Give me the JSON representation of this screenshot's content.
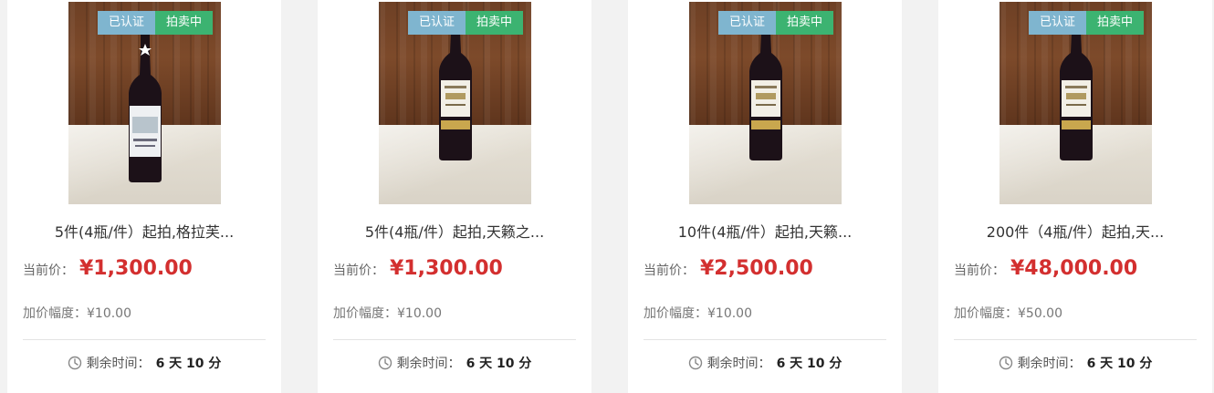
{
  "cards": [
    {
      "badges": {
        "certified": "已认证",
        "status": "拍卖中"
      },
      "title": "5件(4瓶/件）起拍,格拉芙...",
      "price_label": "当前价：",
      "price": "¥1,300.00",
      "increment_label": "加价幅度：",
      "increment": "¥10.00",
      "time_label": "剩余时间：",
      "time_left": "6 天 10 分",
      "bottle_label": "white"
    },
    {
      "badges": {
        "certified": "已认证",
        "status": "拍卖中"
      },
      "title": "5件(4瓶/件）起拍,天籁之...",
      "price_label": "当前价：",
      "price": "¥1,300.00",
      "increment_label": "加价幅度：",
      "increment": "¥10.00",
      "time_label": "剩余时间：",
      "time_left": "6 天 10 分",
      "bottle_label": "cream"
    },
    {
      "badges": {
        "certified": "已认证",
        "status": "拍卖中"
      },
      "title": "10件(4瓶/件）起拍,天籁...",
      "price_label": "当前价：",
      "price": "¥2,500.00",
      "increment_label": "加价幅度：",
      "increment": "¥10.00",
      "time_label": "剩余时间：",
      "time_left": "6 天 10 分",
      "bottle_label": "cream"
    },
    {
      "badges": {
        "certified": "已认证",
        "status": "拍卖中"
      },
      "title": "200件（4瓶/件）起拍,天...",
      "price_label": "当前价：",
      "price": "¥48,000.00",
      "increment_label": "加价幅度：",
      "increment": "¥50.00",
      "time_label": "剩余时间：",
      "time_left": "6 天 10 分",
      "bottle_label": "cream"
    }
  ],
  "colors": {
    "badge_certified": "#7fb5cf",
    "badge_status": "#3cb371",
    "price": "#d32f2f"
  },
  "icons": {
    "time": "clock-icon"
  }
}
